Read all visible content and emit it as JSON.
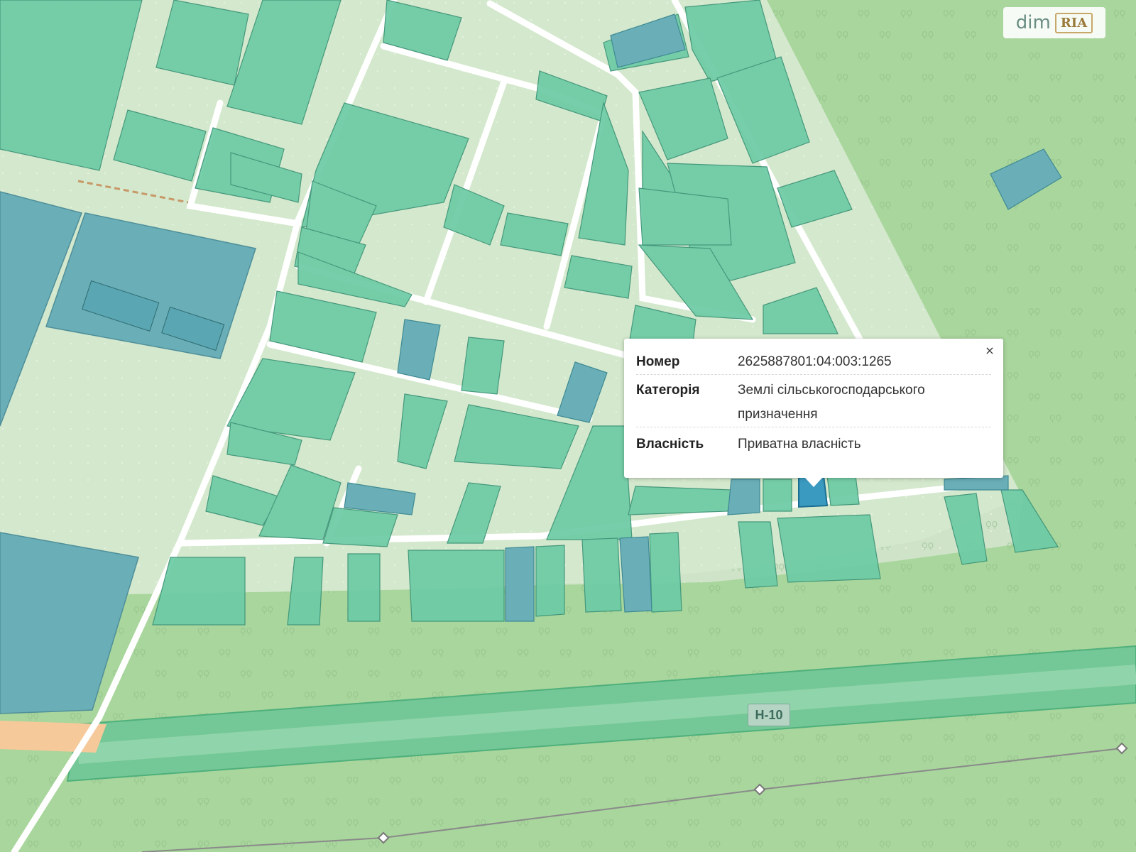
{
  "popup": {
    "close_symbol": "×",
    "rows": [
      {
        "label": "Номер",
        "value": "2625887801:04:003:1265"
      },
      {
        "label": "Категорія",
        "value": "Землі сільськогосподарського\nпризначення"
      },
      {
        "label": "Власність",
        "value": "Приватна власність"
      }
    ]
  },
  "road_label": "Н-10",
  "watermark": {
    "text": "dim",
    "brand": "RIA"
  },
  "colors": {
    "background_field": "#cfe3c8",
    "forest": "#9ecf95",
    "roads": "#ffffff",
    "parcel_green": "#6fcca6",
    "parcel_blue": "#6aaeb8",
    "selected_parcel": "#3a9ac0",
    "highway_band": "#74c796"
  },
  "icons": [
    "close-icon",
    "tree-pattern-icon",
    "map-marker-icon"
  ]
}
